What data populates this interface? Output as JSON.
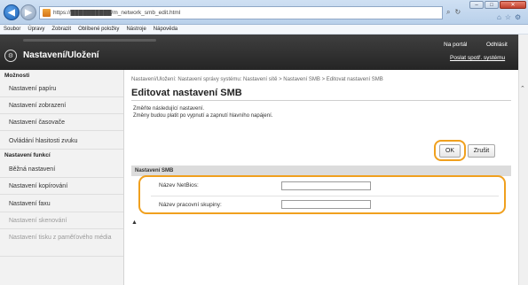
{
  "browser": {
    "url": "https://██████████/m_network_smb_edit.html",
    "search_icon": "⌕",
    "refresh_icon": "↻",
    "menu": [
      "Soubor",
      "Úpravy",
      "Zobrazit",
      "Oblíbené položky",
      "Nástroje",
      "Nápověda"
    ]
  },
  "header": {
    "title": "Nastavení/Uložení",
    "portal": "Na portál",
    "logout": "Odhlásit",
    "supplies": "Poslat spotř. systému"
  },
  "sidebar": {
    "section1": "Možnosti",
    "items1": [
      "Nastavení papíru",
      "Nastavení zobrazení",
      "Nastavení časovače",
      "Ovládání hlasitosti zvuku"
    ],
    "section2": "Nastavení funkcí",
    "items2": [
      "Běžná nastavení",
      "Nastavení kopírování",
      "Nastavení faxu",
      "Nastavení skenování",
      "Nastavení tisku z paměťového média"
    ]
  },
  "main": {
    "breadcrumb": "Nastavení/Uložení: Nastavení správy systému: Nastavení sítě > Nastavení SMB > Editovat nastavení SMB",
    "title": "Editovat nastavení SMB",
    "note1": "Změňte následující nastavení.",
    "note2": "Změny budou platit po vypnutí a zapnutí hlavního napájení.",
    "ok": "OK",
    "cancel": "Zrušit",
    "panel_title": "Nastavení SMB",
    "netbios_label": "Název NetBios:",
    "netbios_value": "",
    "workgroup_label": "Název pracovní skupiny:",
    "workgroup_value": "",
    "top_icon": "▲"
  },
  "colors": {
    "highlight": "#f0a01e",
    "header_bg": "#2f2f2f"
  }
}
